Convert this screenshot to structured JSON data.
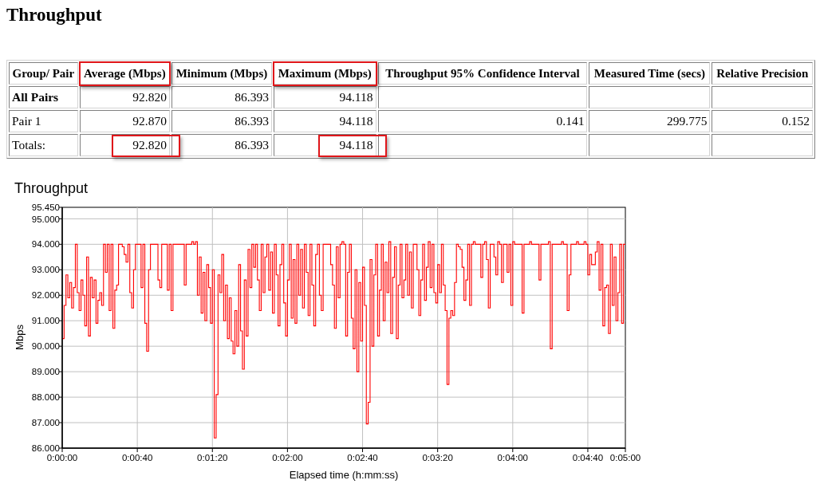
{
  "title": "Throughput",
  "table": {
    "columns": [
      {
        "label": "Group/ Pair",
        "highlighted": false
      },
      {
        "label": "Average (Mbps)",
        "highlighted": true
      },
      {
        "label": "Minimum (Mbps)",
        "highlighted": false
      },
      {
        "label": "Maximum (Mbps)",
        "highlighted": true
      },
      {
        "label": "Throughput 95% Confidence Interval",
        "highlighted": false
      },
      {
        "label": "Measured Time (secs)",
        "highlighted": false
      },
      {
        "label": "Relative Precision",
        "highlighted": false
      }
    ],
    "rows": [
      {
        "kind": "group",
        "cells": [
          {
            "text": "All Pairs",
            "highlighted": false
          },
          {
            "text": "92.820",
            "highlighted": false
          },
          {
            "text": "86.393",
            "highlighted": false
          },
          {
            "text": "94.118",
            "highlighted": false
          },
          {
            "highlighted": false
          },
          {
            "highlighted": false
          },
          {
            "highlighted": false
          }
        ]
      },
      {
        "kind": "pair",
        "cells": [
          {
            "text": "Pair 1",
            "highlighted": false
          },
          {
            "text": "92.870",
            "highlighted": false
          },
          {
            "text": "86.393",
            "highlighted": false
          },
          {
            "text": "94.118",
            "highlighted": false
          },
          {
            "text": "0.141",
            "highlighted": false
          },
          {
            "text": "299.775",
            "highlighted": false
          },
          {
            "text": "0.152",
            "highlighted": false
          }
        ]
      },
      {
        "kind": "totals",
        "cells": [
          {
            "text": "Totals:",
            "highlighted": false
          },
          {
            "text": "92.820",
            "highlighted": true
          },
          {
            "text": "86.393",
            "highlighted": false
          },
          {
            "text": "94.118",
            "highlighted": true
          },
          {
            "highlighted": false
          },
          {
            "highlighted": false
          },
          {
            "highlighted": false
          }
        ]
      }
    ]
  },
  "throughput_chart": {
    "chart_data": {
      "type": "line",
      "title": "Throughput",
      "xlabel": "Elapsed time (h:mm:ss)",
      "ylabel": "Mbps",
      "grid": true,
      "xlim": [
        0,
        300
      ],
      "ylim": [
        86,
        95.45
      ],
      "xticks": [
        {
          "value": 0,
          "label": "0:00:00"
        },
        {
          "value": 40,
          "label": "0:00:40"
        },
        {
          "value": 80,
          "label": "0:01:20"
        },
        {
          "value": 120,
          "label": "0:02:00"
        },
        {
          "value": 160,
          "label": "0:02:40"
        },
        {
          "value": 200,
          "label": "0:03:20"
        },
        {
          "value": 240,
          "label": "0:04:00"
        },
        {
          "value": 280,
          "label": "0:04:40"
        },
        {
          "value": 300,
          "label": "0:05:00"
        }
      ],
      "yticks": [
        {
          "value": 86,
          "label": "86.000"
        },
        {
          "value": 87,
          "label": "87.000"
        },
        {
          "value": 88,
          "label": "88.000"
        },
        {
          "value": 89,
          "label": "89.000"
        },
        {
          "value": 90,
          "label": "90.000"
        },
        {
          "value": 91,
          "label": "91.000"
        },
        {
          "value": 92,
          "label": "92.000"
        },
        {
          "value": 93,
          "label": "93.000"
        },
        {
          "value": 94,
          "label": "94.000"
        },
        {
          "value": 95,
          "label": "95.000"
        },
        {
          "value": 95.45,
          "label": "95.450"
        }
      ],
      "x": [
        0,
        1,
        2,
        3,
        4,
        5,
        6,
        7,
        8,
        9,
        10,
        11,
        12,
        13,
        14,
        15,
        16,
        17,
        18,
        19,
        20,
        21,
        22,
        23,
        24,
        25,
        26,
        27,
        28,
        29,
        30,
        31,
        32,
        33,
        34,
        35,
        36,
        37,
        38,
        39,
        40,
        41,
        42,
        43,
        44,
        45,
        46,
        47,
        48,
        49,
        50,
        51,
        52,
        53,
        54,
        55,
        56,
        57,
        58,
        59,
        60,
        61,
        62,
        63,
        64,
        65,
        66,
        67,
        68,
        69,
        70,
        71,
        72,
        73,
        74,
        75,
        76,
        77,
        78,
        79,
        80,
        81,
        82,
        83,
        84,
        85,
        86,
        87,
        88,
        89,
        90,
        91,
        92,
        93,
        94,
        95,
        96,
        97,
        98,
        99,
        100,
        101,
        102,
        103,
        104,
        105,
        106,
        107,
        108,
        109,
        110,
        111,
        112,
        113,
        114,
        115,
        116,
        117,
        118,
        119,
        120,
        121,
        122,
        123,
        124,
        125,
        126,
        127,
        128,
        129,
        130,
        131,
        132,
        133,
        134,
        135,
        136,
        137,
        138,
        139,
        140,
        141,
        142,
        143,
        144,
        145,
        146,
        147,
        148,
        149,
        150,
        151,
        152,
        153,
        154,
        155,
        156,
        157,
        158,
        159,
        160,
        161,
        162,
        163,
        164,
        165,
        166,
        167,
        168,
        169,
        170,
        171,
        172,
        173,
        174,
        175,
        176,
        177,
        178,
        179,
        180,
        181,
        182,
        183,
        184,
        185,
        186,
        187,
        188,
        189,
        190,
        191,
        192,
        193,
        194,
        195,
        196,
        197,
        198,
        199,
        200,
        201,
        202,
        203,
        204,
        205,
        206,
        207,
        208,
        209,
        210,
        211,
        212,
        213,
        214,
        215,
        216,
        217,
        218,
        219,
        220,
        221,
        222,
        223,
        224,
        225,
        226,
        227,
        228,
        229,
        230,
        231,
        232,
        233,
        234,
        235,
        236,
        237,
        238,
        239,
        240,
        241,
        242,
        243,
        244,
        245,
        246,
        247,
        248,
        249,
        250,
        251,
        252,
        253,
        254,
        255,
        256,
        257,
        258,
        259,
        260,
        261,
        262,
        263,
        264,
        265,
        266,
        267,
        268,
        269,
        270,
        271,
        272,
        273,
        274,
        275,
        276,
        277,
        278,
        279,
        280,
        281,
        282,
        283,
        284,
        285,
        286,
        287,
        288,
        289,
        290,
        291,
        292,
        293,
        294,
        295,
        296,
        297,
        298,
        299,
        300
      ],
      "series": [
        {
          "color": "#ff0000",
          "values": [
            90.3,
            91.6,
            92.8,
            91.9,
            92.5,
            91.5,
            92.3,
            94.0,
            92.1,
            91.4,
            92.6,
            92.0,
            90.8,
            93.5,
            90.4,
            92.7,
            91.9,
            92.6,
            90.9,
            91.8,
            92.1,
            91.6,
            94.0,
            92.9,
            94.0,
            91.4,
            94.0,
            90.7,
            92.2,
            92.4,
            94.0,
            94.0,
            93.9,
            93.6,
            93.3,
            94.0,
            92.1,
            91.5,
            93.0,
            94.0,
            94.0,
            94.0,
            92.3,
            94.0,
            90.9,
            89.8,
            93.0,
            94.0,
            94.0,
            94.0,
            94.0,
            92.6,
            92.3,
            94.0,
            94.0,
            94.0,
            92.2,
            94.0,
            91.4,
            94.0,
            94.0,
            94.0,
            94.0,
            94.0,
            94.0,
            92.4,
            94.0,
            94.0,
            94.0,
            94.1,
            94.0,
            94.1,
            92.0,
            93.5,
            91.3,
            92.9,
            91.0,
            93.2,
            92.3,
            90.9,
            93.0,
            86.4,
            88.1,
            92.8,
            92.1,
            93.6,
            91.0,
            92.4,
            90.3,
            91.9,
            90.2,
            89.7,
            91.4,
            90.0,
            93.2,
            90.6,
            89.1,
            92.6,
            90.4,
            93.8,
            92.3,
            94.0,
            93.1,
            94.0,
            92.6,
            91.4,
            94.0,
            92.1,
            93.5,
            94.0,
            92.2,
            93.7,
            91.3,
            94.0,
            92.8,
            90.8,
            93.2,
            94.0,
            91.7,
            90.4,
            92.6,
            94.0,
            91.1,
            93.4,
            90.9,
            94.0,
            92.0,
            93.8,
            91.5,
            94.0,
            92.9,
            91.2,
            94.0,
            92.4,
            90.8,
            93.6,
            94.0,
            92.0,
            91.4,
            94.0,
            94.0,
            94.0,
            94.0,
            93.2,
            92.4,
            90.7,
            93.9,
            91.9,
            94.0,
            94.1,
            94.0,
            90.4,
            92.9,
            94.0,
            91.1,
            89.9,
            93.0,
            89.0,
            92.5,
            90.2,
            93.1,
            91.6,
            86.95,
            87.8,
            93.4,
            90.0,
            92.8,
            94.0,
            90.4,
            92.2,
            94.0,
            91.0,
            93.3,
            92.1,
            94.1,
            90.5,
            92.7,
            93.9,
            90.3,
            92.4,
            94.0,
            91.9,
            92.6,
            94.0,
            92.0,
            93.7,
            91.5,
            94.0,
            94.0,
            93.0,
            91.2,
            92.6,
            94.0,
            91.8,
            93.1,
            94.1,
            92.3,
            94.0,
            92.1,
            91.7,
            93.2,
            92.1,
            94.0,
            92.4,
            91.4,
            88.5,
            91.1,
            91.4,
            91.2,
            92.5,
            94.0,
            93.9,
            93.8,
            93.1,
            91.8,
            92.6,
            94.0,
            91.6,
            94.0,
            94.1,
            94.0,
            94.0,
            94.0,
            92.7,
            94.0,
            94.1,
            93.4,
            91.5,
            94.0,
            94.0,
            93.5,
            92.8,
            94.1,
            94.0,
            92.5,
            94.0,
            94.0,
            92.9,
            94.0,
            91.6,
            94.1,
            94.0,
            94.0,
            94.0,
            94.0,
            91.3,
            94.0,
            94.0,
            94.0,
            94.1,
            94.0,
            94.0,
            94.0,
            94.0,
            92.6,
            94.0,
            94.0,
            94.0,
            94.0,
            94.1,
            89.9,
            94.0,
            94.0,
            94.0,
            94.0,
            94.0,
            94.1,
            94.0,
            94.0,
            91.4,
            92.8,
            94.0,
            94.0,
            94.0,
            94.1,
            94.0,
            94.0,
            94.0,
            94.1,
            94.0,
            92.8,
            93.6,
            93.2,
            93.2,
            93.7,
            94.1,
            92.2,
            94.0,
            90.8,
            92.3,
            92.4,
            90.5,
            94.0,
            91.6,
            93.5,
            91.0,
            92.1,
            94.0,
            90.9,
            94.0,
            94.0
          ]
        }
      ]
    }
  }
}
